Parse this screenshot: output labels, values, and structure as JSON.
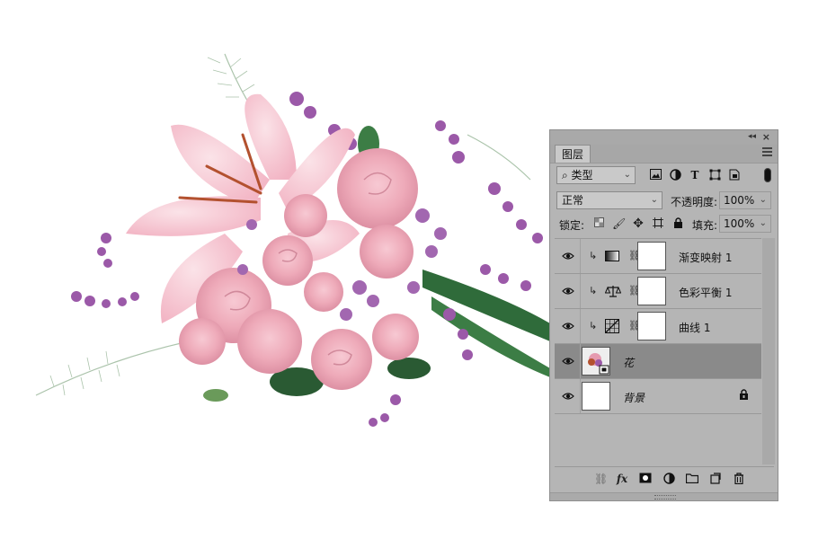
{
  "panel": {
    "tab_label": "图层",
    "filter_kind": "类型",
    "blend_mode": "正常",
    "opacity_label": "不透明度:",
    "opacity_value": "100%",
    "lock_label": "锁定:",
    "fill_label": "填充:",
    "fill_value": "100%"
  },
  "layers": [
    {
      "name": "渐变映射 1",
      "type": "adjustment",
      "adjustment_icon": "gradient-map-icon",
      "clipped": true,
      "visible": true,
      "selected": false
    },
    {
      "name": "色彩平衡 1",
      "type": "adjustment",
      "adjustment_icon": "balance-scale-icon",
      "clipped": true,
      "visible": true,
      "selected": false
    },
    {
      "name": "曲线 1",
      "type": "adjustment",
      "adjustment_icon": "curves-icon",
      "clipped": true,
      "visible": true,
      "selected": false
    },
    {
      "name": "花",
      "type": "smart-object",
      "visible": true,
      "selected": true
    },
    {
      "name": "背景",
      "type": "background",
      "locked": true,
      "visible": true,
      "selected": false
    }
  ],
  "colors": {
    "panel_bg": "#b5b5b5",
    "selected_layer": "#8a8a8a",
    "rose_pink": "#f3b9c6",
    "lilac": "#9b59a8",
    "leaf_green": "#2f6b3a"
  }
}
